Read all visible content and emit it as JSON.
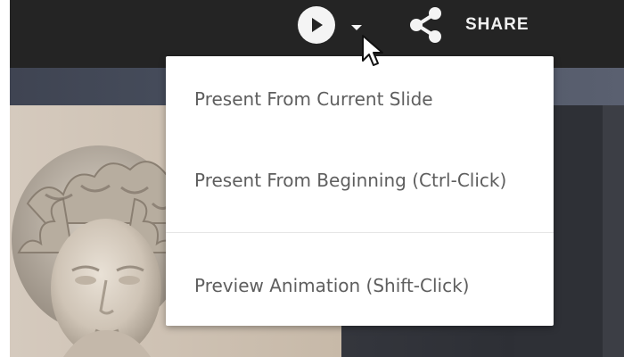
{
  "toolbar": {
    "play_icon": "play-icon",
    "dropdown_icon": "caret-down-icon",
    "share_icon": "share-icon",
    "share_label": "SHARE",
    "colors": {
      "bar": "#242424",
      "icon": "#f4f4f4"
    }
  },
  "present_menu": {
    "items": [
      {
        "label": "Present From Current Slide"
      },
      {
        "label": "Present From Beginning (Ctrl-Click)"
      },
      {
        "label": "Preview Animation (Shift-Click)"
      }
    ],
    "text_color": "#5e5e5e"
  },
  "slide": {
    "image_subject": "classical-marble-bust"
  },
  "cursor": {
    "icon": "mouse-pointer-icon"
  }
}
